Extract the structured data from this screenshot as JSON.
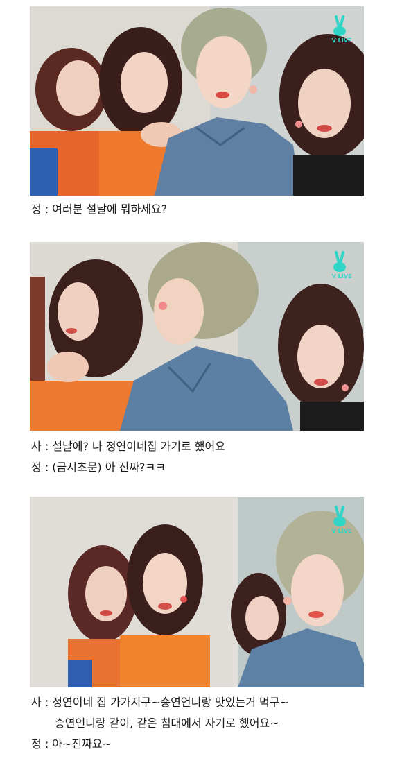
{
  "watermark": {
    "text": "V LIVE",
    "icon": "vlive-peace-sign-icon"
  },
  "frames": [
    {
      "captions": [
        {
          "speaker": "정",
          "sep": " : ",
          "text": "여러분 설날에 뭐하세요?"
        }
      ]
    },
    {
      "captions": [
        {
          "speaker": "사",
          "sep": " : ",
          "text": "설날에? 나 정연이네집 가기로 했어요"
        },
        {
          "speaker": "정",
          "sep": " : ",
          "text": "(금시초문) 아 진짜?ㅋㅋ"
        }
      ]
    },
    {
      "captions": [
        {
          "speaker": "사",
          "sep": " : ",
          "text": "정연이네 집 가가지구~승연언니랑 맛있는거 먹구~"
        },
        {
          "speaker": "",
          "sep": "",
          "text": "승연언니랑 같이, 같은 침대에서 자기로 했어요~"
        },
        {
          "speaker": "정",
          "sep": " : ",
          "text": "아~진짜요~"
        }
      ]
    }
  ],
  "colors": {
    "vlive_accent": "#2fd6c8",
    "caption_text": "#1a1a1a"
  }
}
